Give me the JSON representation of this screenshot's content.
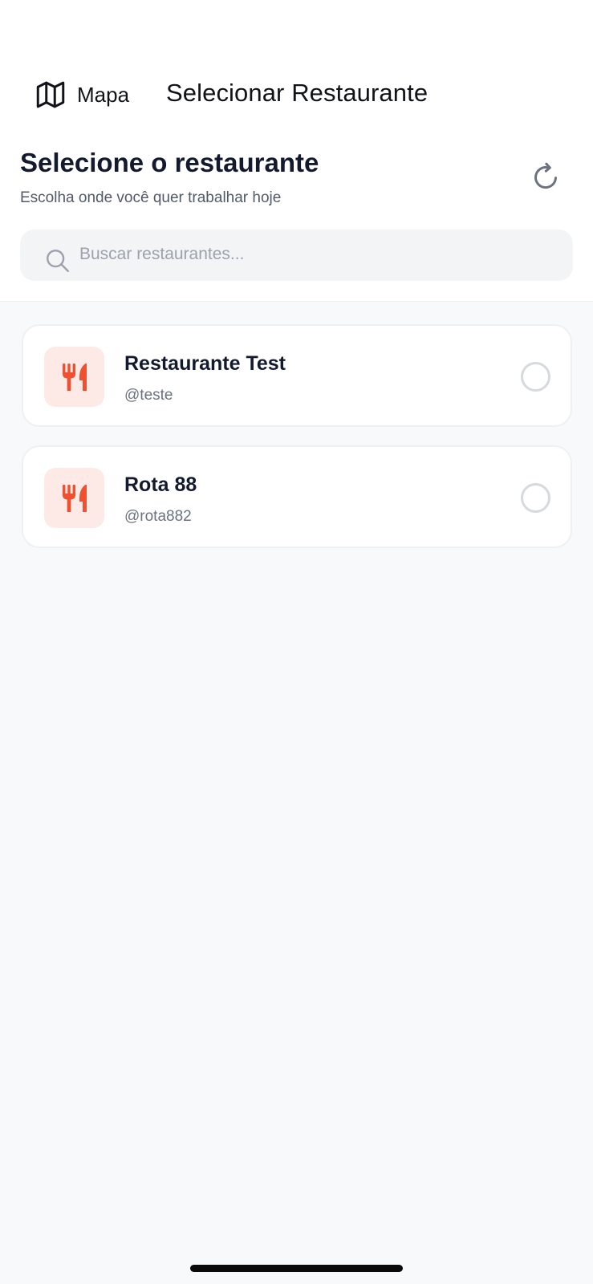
{
  "nav": {
    "back_label": "Mapa",
    "back_icon": "map-icon",
    "title": "Selecionar Restaurante"
  },
  "header": {
    "title": "Selecione o restaurante",
    "subtitle": "Escolha onde você quer trabalhar hoje",
    "refresh_icon": "refresh-icon"
  },
  "search": {
    "placeholder": "Buscar restaurantes...",
    "value": "",
    "icon": "search-icon"
  },
  "restaurants": [
    {
      "name": "Restaurante Test",
      "handle": "@teste",
      "icon": "utensils-icon",
      "selected": false
    },
    {
      "name": "Rota 88",
      "handle": "@rota882",
      "icon": "utensils-icon",
      "selected": false
    }
  ],
  "colors": {
    "accent": "#f0502f",
    "accent_bg": "#fde9e6",
    "text_primary": "#141a2e",
    "text_secondary": "#6b7280"
  }
}
